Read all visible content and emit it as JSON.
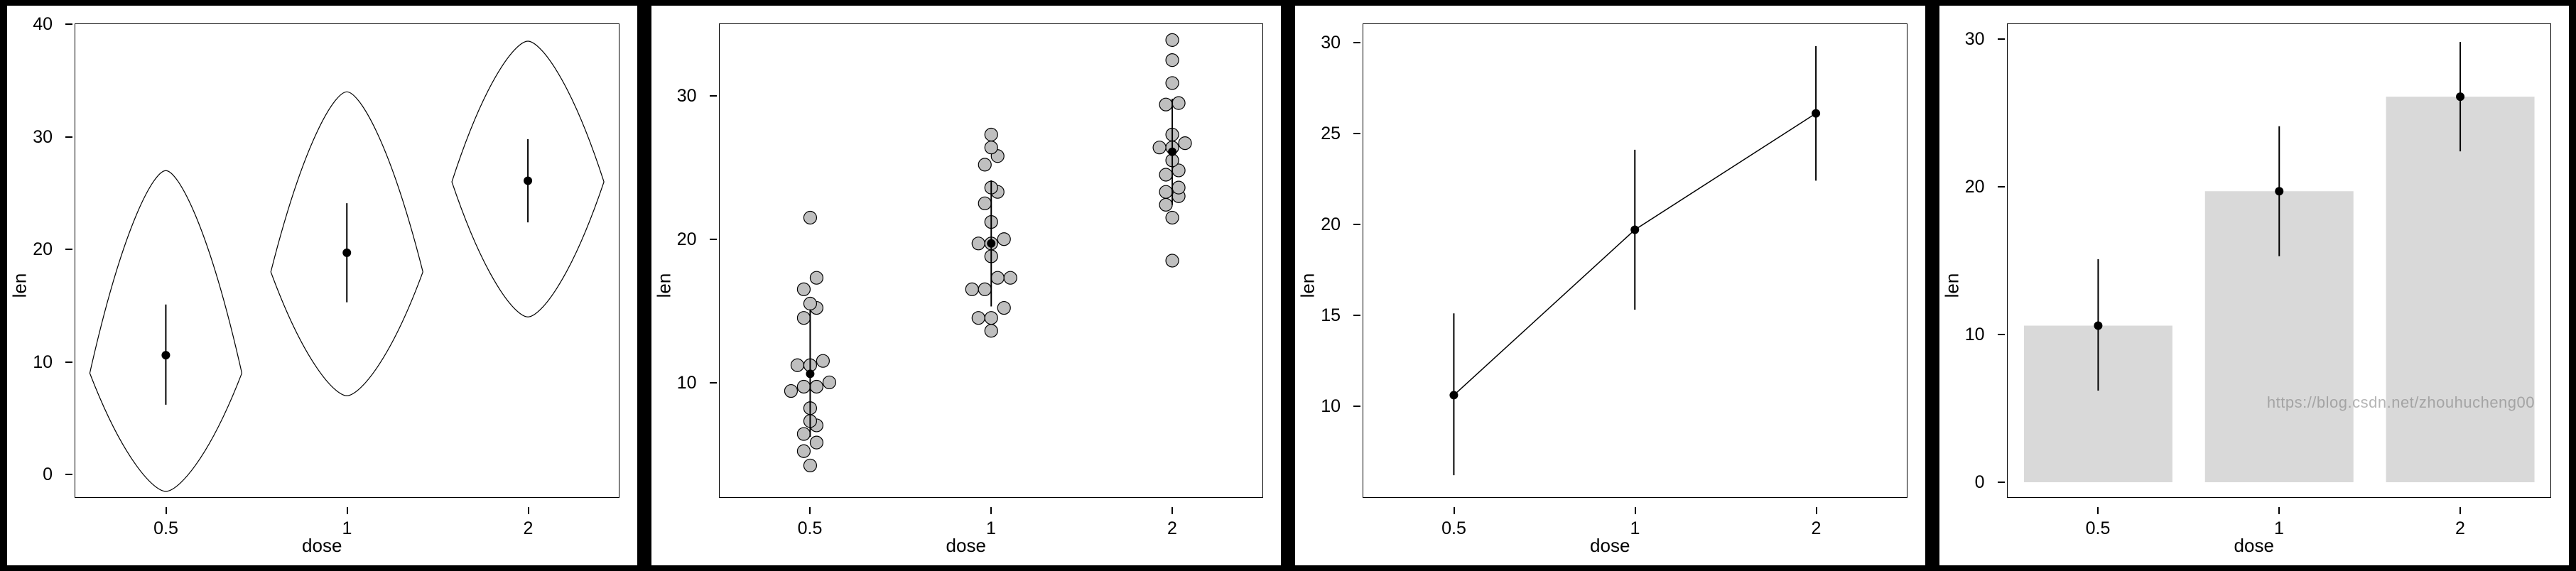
{
  "watermark": "https://blog.csdn.net/zhouhucheng00",
  "common": {
    "xlabel": "dose",
    "ylabel": "len",
    "categories": [
      "0.5",
      "1",
      "2"
    ]
  },
  "chart_data": [
    {
      "type": "violin",
      "categories": [
        "0.5",
        "1",
        "2"
      ],
      "xlabel": "dose",
      "ylabel": "len",
      "ylim": [
        -2,
        40
      ],
      "yticks": [
        0,
        10,
        20,
        30,
        40
      ],
      "summary": [
        {
          "category": "0.5",
          "mean": 10.6,
          "sd_low": 6.2,
          "sd_high": 15.1,
          "min": -1.5,
          "max": 27.0,
          "widest_y": 9.0
        },
        {
          "category": "1",
          "mean": 19.7,
          "sd_low": 15.3,
          "sd_high": 24.1,
          "min": 7.0,
          "max": 34.0,
          "widest_y": 18.0
        },
        {
          "category": "2",
          "mean": 26.1,
          "sd_low": 22.4,
          "sd_high": 29.8,
          "min": 14.0,
          "max": 38.5,
          "widest_y": 26.0
        }
      ]
    },
    {
      "type": "dot",
      "categories": [
        "0.5",
        "1",
        "2"
      ],
      "xlabel": "dose",
      "ylabel": "len",
      "ylim": [
        2,
        35
      ],
      "yticks": [
        10,
        20,
        30
      ],
      "summary": [
        {
          "category": "0.5",
          "mean": 10.6,
          "sd_low": 6.2,
          "sd_high": 15.1
        },
        {
          "category": "1",
          "mean": 19.7,
          "sd_low": 15.3,
          "sd_high": 24.1
        },
        {
          "category": "2",
          "mean": 26.1,
          "sd_low": 22.4,
          "sd_high": 29.8
        }
      ],
      "points": {
        "0.5": [
          4.2,
          5.2,
          5.8,
          6.4,
          7.0,
          7.3,
          8.2,
          9.4,
          9.7,
          9.7,
          10.0,
          11.2,
          11.2,
          11.5,
          14.5,
          15.2,
          15.5,
          16.5,
          17.3,
          21.5
        ],
        "1": [
          13.6,
          14.5,
          14.5,
          15.2,
          16.5,
          16.5,
          17.3,
          17.3,
          18.8,
          19.7,
          19.7,
          20.0,
          21.2,
          22.5,
          23.3,
          23.6,
          25.2,
          25.8,
          26.4,
          27.3
        ],
        "2": [
          18.5,
          21.5,
          22.4,
          23.0,
          23.3,
          23.6,
          24.5,
          24.8,
          25.5,
          26.4,
          26.4,
          26.7,
          27.3,
          29.4,
          29.5,
          30.9,
          32.5,
          33.9
        ]
      }
    },
    {
      "type": "line",
      "categories": [
        "0.5",
        "1",
        "2"
      ],
      "xlabel": "dose",
      "ylabel": "len",
      "ylim": [
        5,
        31
      ],
      "yticks": [
        10,
        15,
        20,
        25,
        30
      ],
      "summary": [
        {
          "category": "0.5",
          "mean": 10.6,
          "sd_low": 6.2,
          "sd_high": 15.1
        },
        {
          "category": "1",
          "mean": 19.7,
          "sd_low": 15.3,
          "sd_high": 24.1
        },
        {
          "category": "2",
          "mean": 26.1,
          "sd_low": 22.4,
          "sd_high": 29.8
        }
      ]
    },
    {
      "type": "bar",
      "categories": [
        "0.5",
        "1",
        "2"
      ],
      "xlabel": "dose",
      "ylabel": "len",
      "ylim": [
        -1,
        31
      ],
      "yticks": [
        0,
        10,
        20,
        30
      ],
      "summary": [
        {
          "category": "0.5",
          "mean": 10.6,
          "sd_low": 6.2,
          "sd_high": 15.1
        },
        {
          "category": "1",
          "mean": 19.7,
          "sd_low": 15.3,
          "sd_high": 24.1
        },
        {
          "category": "2",
          "mean": 26.1,
          "sd_low": 22.4,
          "sd_high": 29.8
        }
      ]
    }
  ]
}
